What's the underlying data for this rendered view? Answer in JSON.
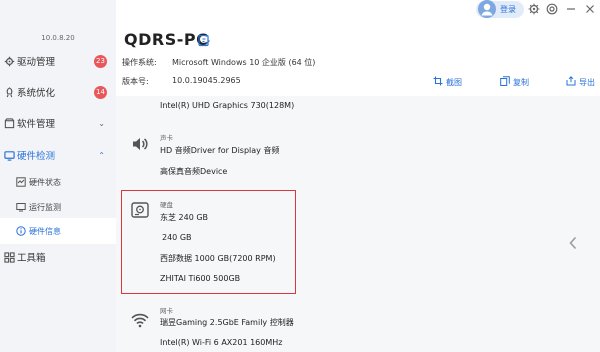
{
  "app": {
    "version": "10.0.8.20"
  },
  "topbar": {
    "login_label": "登录"
  },
  "sidebar": {
    "items": [
      {
        "label": "驱动管理",
        "badge": "23"
      },
      {
        "label": "系统优化",
        "badge": "14"
      },
      {
        "label": "软件管理",
        "chevron": "⌄"
      },
      {
        "label": "硬件检测",
        "chevron": "⌃"
      },
      {
        "label": "硬件状态"
      },
      {
        "label": "运行监测"
      },
      {
        "label": "硬件信息"
      },
      {
        "label": "工具箱"
      }
    ]
  },
  "header": {
    "pc_name": "QDRS-PC",
    "os_label": "操作系统:",
    "os_value": "Microsoft Windows 10 企业版 (64 位)",
    "ver_label": "版本号:",
    "ver_value": "10.0.19045.2965",
    "actions": {
      "screenshot": "截图",
      "copy": "复制",
      "export": "导出"
    }
  },
  "hardware": {
    "gpu_line": "Intel(R) UHD Graphics 730(128M)",
    "sound": {
      "category": "声卡",
      "lines": [
        "HD 音频Driver for Display 音频",
        "高保真音频Device"
      ]
    },
    "disk": {
      "category": "硬盘",
      "lines": [
        "东芝  240 GB",
        "240 GB",
        "西部数据  1000 GB(7200 RPM)",
        "ZHITAI Ti600 500GB"
      ]
    },
    "network": {
      "category": "网卡",
      "lines": [
        "瑞昱Gaming 2.5GbE  Family 控制器",
        "Intel(R) Wi-Fi 6 AX201 160MHz"
      ]
    }
  },
  "colors": {
    "accent": "#2a72d9",
    "badge": "#e9575b",
    "highlight": "#d9363e",
    "sidebar_bg": "#f2f4f7"
  }
}
